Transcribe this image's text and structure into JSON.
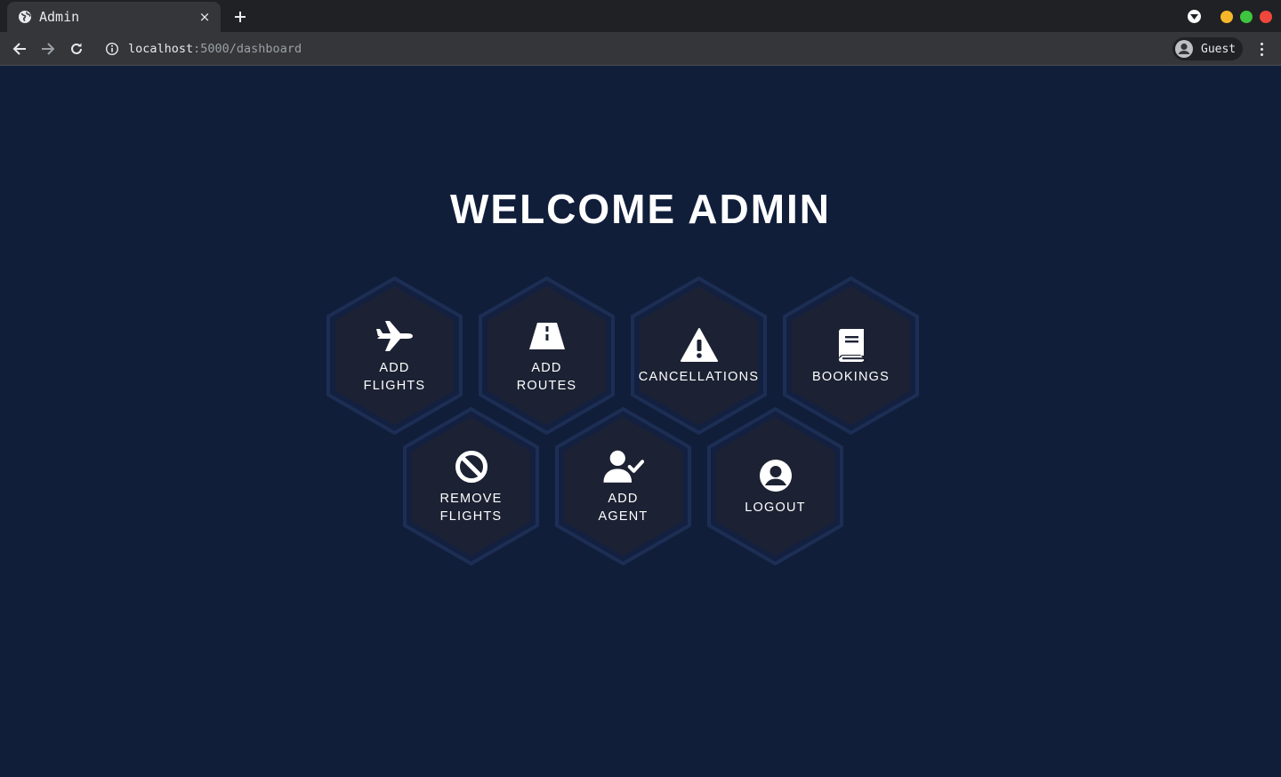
{
  "browser": {
    "tab_title": "Admin",
    "tab_close": "×",
    "url_host": "localhost",
    "url_path": ":5000/dashboard",
    "profile_name": "Guest",
    "window_dots": [
      "#f5b72a",
      "#3fc43f",
      "#f0473c"
    ]
  },
  "page": {
    "title": "WELCOME ADMIN",
    "background": "#101e3a",
    "hex_fill": "#1c2233",
    "hex_border": "#1d2e55"
  },
  "menu": [
    {
      "label": "ADD\nFLIGHTS",
      "icon": "plane-icon"
    },
    {
      "label": "ADD\nROUTES",
      "icon": "road-icon"
    },
    {
      "label": "CANCELLATIONS",
      "icon": "warning-icon"
    },
    {
      "label": "BOOKINGS",
      "icon": "book-icon"
    },
    {
      "label": "REMOVE\nFLIGHTS",
      "icon": "ban-icon"
    },
    {
      "label": "ADD\nAGENT",
      "icon": "user-check-icon"
    },
    {
      "label": "LOGOUT",
      "icon": "user-circle-icon"
    }
  ]
}
